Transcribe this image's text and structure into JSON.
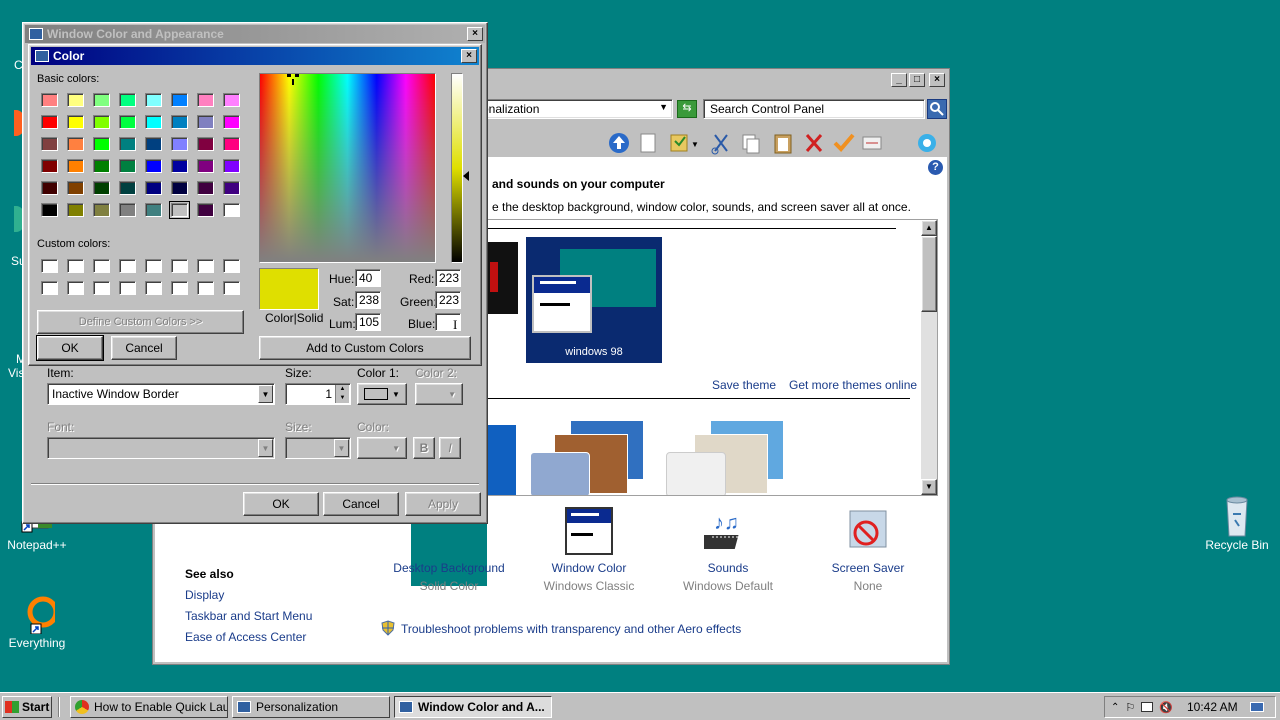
{
  "desktop": {
    "icons": [
      {
        "label": "Notepad++"
      },
      {
        "label": "Everything"
      },
      {
        "label": "Recycle Bin"
      }
    ],
    "partial_labels": [
      "C",
      "Su",
      "M",
      "Vis"
    ]
  },
  "personalization": {
    "address": "Personalization",
    "address_visible": "onalization",
    "search_placeholder": "Search Control Panel",
    "heading": "and sounds on your computer",
    "description": "e the desktop background, window color, sounds, and screen saver all at once.",
    "theme_label": "windows 98",
    "save_theme": "Save theme",
    "more_themes": "Get more themes online",
    "see_also_title": "See also",
    "see_also": [
      "Display",
      "Taskbar and Start Menu",
      "Ease of Access Center"
    ],
    "bottom_items": [
      {
        "title": "Desktop Background",
        "sub": "Solid Color"
      },
      {
        "title": "Window Color",
        "sub": "Windows Classic"
      },
      {
        "title": "Sounds",
        "sub": "Windows Default"
      },
      {
        "title": "Screen Saver",
        "sub": "None"
      }
    ],
    "troubleshoot": "Troubleshoot problems with transparency and other Aero effects"
  },
  "wca": {
    "title": "Window Color and Appearance",
    "item_label": "Item:",
    "item_value": "Inactive Window Border",
    "size_label": "Size:",
    "size_value": "1",
    "color1_label": "Color 1:",
    "color2_label": "Color 2:",
    "font_label": "Font:",
    "size2_label": "Size:",
    "color3_label": "Color:",
    "bold": "B",
    "italic": "I",
    "ok": "OK",
    "cancel": "Cancel",
    "apply": "Apply"
  },
  "color_dialog": {
    "title": "Color",
    "basic_colors_label": "Basic colors:",
    "custom_colors_label": "Custom colors:",
    "define_custom": "Define Custom Colors >>",
    "ok": "OK",
    "cancel": "Cancel",
    "add_custom": "Add to Custom Colors",
    "color_solid": "Color|Solid",
    "hue_label": "Hue:",
    "hue": "40",
    "sat_label": "Sat:",
    "sat": "238",
    "lum_label": "Lum:",
    "lum": "105",
    "red_label": "Red:",
    "red": "223",
    "green_label": "Green:",
    "green": "223",
    "blue_label": "Blue:",
    "blue": "",
    "current_color": "#dfdf00",
    "basic_colors": [
      "#ff8080",
      "#ffff80",
      "#80ff80",
      "#00ff80",
      "#80ffff",
      "#0080ff",
      "#ff80c0",
      "#ff80ff",
      "#ff0000",
      "#ffff00",
      "#80ff00",
      "#00ff40",
      "#00ffff",
      "#0080c0",
      "#8080c0",
      "#ff00ff",
      "#804040",
      "#ff8040",
      "#00ff00",
      "#008080",
      "#004080",
      "#8080ff",
      "#800040",
      "#ff0080",
      "#800000",
      "#ff8000",
      "#008000",
      "#008040",
      "#0000ff",
      "#0000a0",
      "#800080",
      "#8000ff",
      "#400000",
      "#804000",
      "#004000",
      "#004040",
      "#000080",
      "#000040",
      "#400040",
      "#400080",
      "#000000",
      "#808000",
      "#808040",
      "#808080",
      "#408080",
      "#c0c0c0",
      "#400040",
      "#ffffff"
    ]
  },
  "taskbar": {
    "start": "Start",
    "tasks": [
      "How to Enable Quick Lau...",
      "Personalization",
      "Window Color and A..."
    ],
    "clock": "10:42 AM"
  }
}
